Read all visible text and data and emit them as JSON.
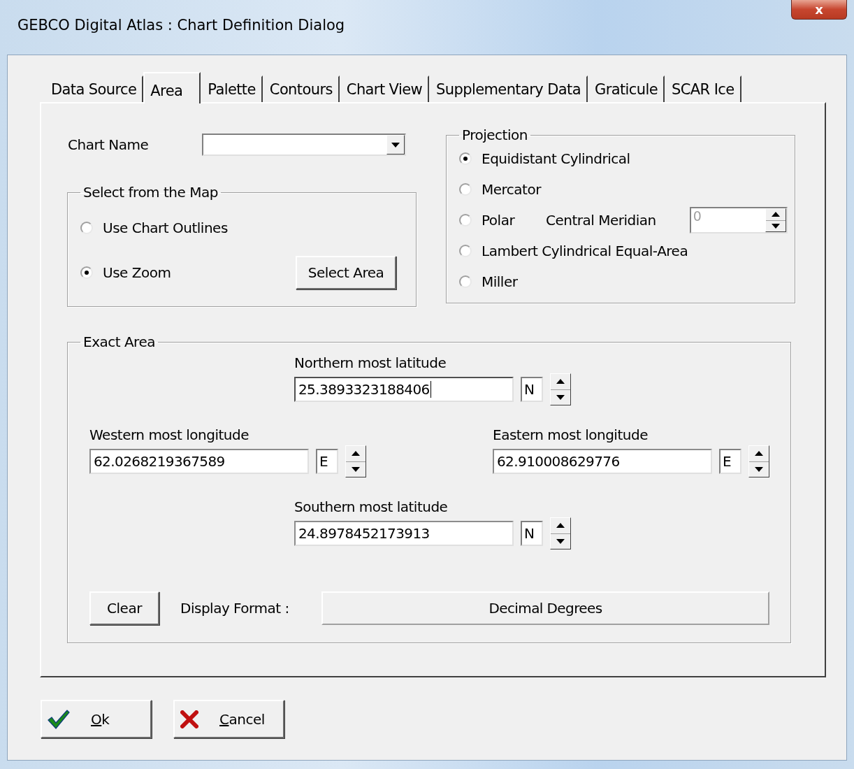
{
  "window": {
    "title": "GEBCO Digital Atlas : Chart Definition Dialog",
    "close": "x"
  },
  "tabs": [
    {
      "label": "Data Source",
      "selected": false
    },
    {
      "label": "Area",
      "selected": true
    },
    {
      "label": "Palette",
      "selected": false
    },
    {
      "label": "Contours",
      "selected": false
    },
    {
      "label": "Chart View",
      "selected": false
    },
    {
      "label": "Supplementary Data",
      "selected": false
    },
    {
      "label": "Graticule",
      "selected": false
    },
    {
      "label": "SCAR Ice",
      "selected": false
    }
  ],
  "chart_name": {
    "label": "Chart Name"
  },
  "select_from_map": {
    "title": "Select from the Map",
    "options": [
      {
        "label": "Use Chart Outlines",
        "selected": false
      },
      {
        "label": "Use Zoom",
        "selected": true
      }
    ],
    "button": "Select Area"
  },
  "projection": {
    "title": "Projection",
    "options": [
      {
        "label": "Equidistant Cylindrical",
        "selected": true
      },
      {
        "label": "Mercator",
        "selected": false
      },
      {
        "label": "Polar",
        "selected": false,
        "extra": {
          "label": "Central Meridian",
          "value": "0",
          "disabled": true
        }
      },
      {
        "label": "Lambert Cylindrical Equal-Area",
        "selected": false
      },
      {
        "label": "Miller",
        "selected": false
      }
    ]
  },
  "exact_area": {
    "title": "Exact Area",
    "fields": [
      {
        "kind": "north",
        "label": "Northern most latitude",
        "value": "25.3893323188406",
        "hemisphere": "N",
        "focused": true
      },
      {
        "kind": "west",
        "label": "Western most longitude",
        "value": "62.0268219367589",
        "hemisphere": "E",
        "focused": false
      },
      {
        "kind": "east",
        "label": "Eastern most longitude",
        "value": "62.910008629776",
        "hemisphere": "E",
        "focused": false
      },
      {
        "kind": "south",
        "label": "Southern most latitude",
        "value": "24.8978452173913",
        "hemisphere": "N",
        "focused": false
      }
    ],
    "clear": "Clear",
    "display_format_label": "Display Format :",
    "display_format": "Decimal Degrees"
  },
  "buttons": [
    {
      "kind": "ok",
      "label": "Ok",
      "underline_first": true
    },
    {
      "kind": "cancel",
      "label": "Cancel",
      "underline_first": true
    }
  ]
}
